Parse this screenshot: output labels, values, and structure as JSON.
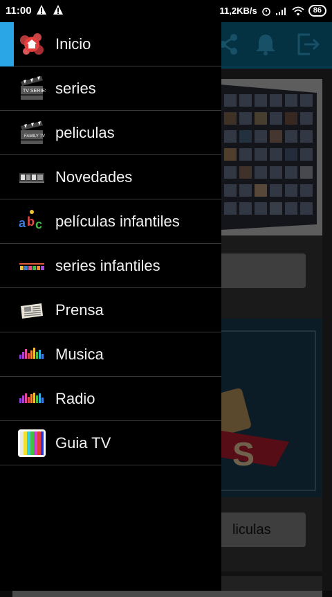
{
  "status_bar": {
    "time": "11:00",
    "network_speed": "11,2KB/s",
    "battery": "86"
  },
  "background": {
    "card2_button_label": "liculas"
  },
  "drawer": {
    "items": [
      {
        "label": "Inicio",
        "icon": "home-icon",
        "active": true
      },
      {
        "label": "series",
        "icon": "tv-series-icon"
      },
      {
        "label": "peliculas",
        "icon": "clapperboard-icon"
      },
      {
        "label": "Novedades",
        "icon": "novedades-icon"
      },
      {
        "label": "películas infantiles",
        "icon": "abc-icon"
      },
      {
        "label": "series infantiles",
        "icon": "kids-icon"
      },
      {
        "label": "Prensa",
        "icon": "newspaper-icon"
      },
      {
        "label": "Musica",
        "icon": "equalizer-icon"
      },
      {
        "label": "Radio",
        "icon": "radio-equalizer-icon"
      },
      {
        "label": "Guia TV",
        "icon": "color-bars-icon"
      }
    ]
  },
  "colors": {
    "accent": "#2aa6e6",
    "toolbar": "#0c6f95",
    "drawer_bg": "#000000",
    "divider": "#3a3a3a"
  }
}
